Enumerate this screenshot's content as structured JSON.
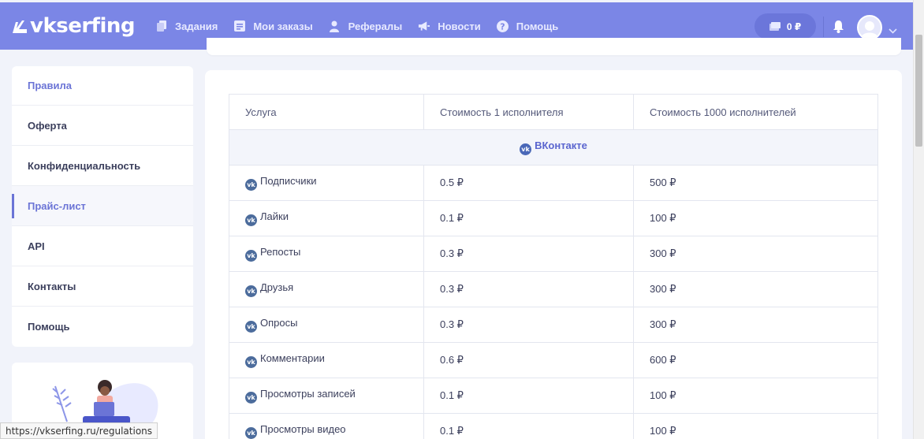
{
  "app": {
    "logo_text": "vkserfing",
    "balance": "0 ₽",
    "status_url": "https://vkserfing.ru/regulations"
  },
  "nav": [
    {
      "label": "Задания",
      "icon": "copy-icon"
    },
    {
      "label": "Мои заказы",
      "icon": "list-icon"
    },
    {
      "label": "Рефералы",
      "icon": "user-icon"
    },
    {
      "label": "Новости",
      "icon": "megaphone-icon"
    },
    {
      "label": "Помощь",
      "icon": "question-icon"
    }
  ],
  "sidebar": {
    "items": [
      {
        "label": "Правила"
      },
      {
        "label": "Оферта"
      },
      {
        "label": "Конфиденциальность"
      },
      {
        "label": "Прайс-лист"
      },
      {
        "label": "API"
      },
      {
        "label": "Контакты"
      },
      {
        "label": "Помощь"
      }
    ]
  },
  "table": {
    "headers": [
      "Услуга",
      "Стоимость 1 исполнителя",
      "Стоимость 1000 исполнителей"
    ],
    "group": "ВКонтакте",
    "rows": [
      {
        "service": "Подписчики",
        "price1": "0.5 ₽",
        "price1000": "500 ₽"
      },
      {
        "service": "Лайки",
        "price1": "0.1 ₽",
        "price1000": "100 ₽"
      },
      {
        "service": "Репосты",
        "price1": "0.3 ₽",
        "price1000": "300 ₽"
      },
      {
        "service": "Друзья",
        "price1": "0.3 ₽",
        "price1000": "300 ₽"
      },
      {
        "service": "Опросы",
        "price1": "0.3 ₽",
        "price1000": "300 ₽"
      },
      {
        "service": "Комментарии",
        "price1": "0.6 ₽",
        "price1000": "600 ₽"
      },
      {
        "service": "Просмотры записей",
        "price1": "0.1 ₽",
        "price1000": "100 ₽"
      },
      {
        "service": "Просмотры видео",
        "price1": "0.1 ₽",
        "price1000": "100 ₽"
      }
    ]
  },
  "colors": {
    "header": "#7b86e6",
    "accent": "#6b74d6",
    "background": "#f1f3fa"
  }
}
